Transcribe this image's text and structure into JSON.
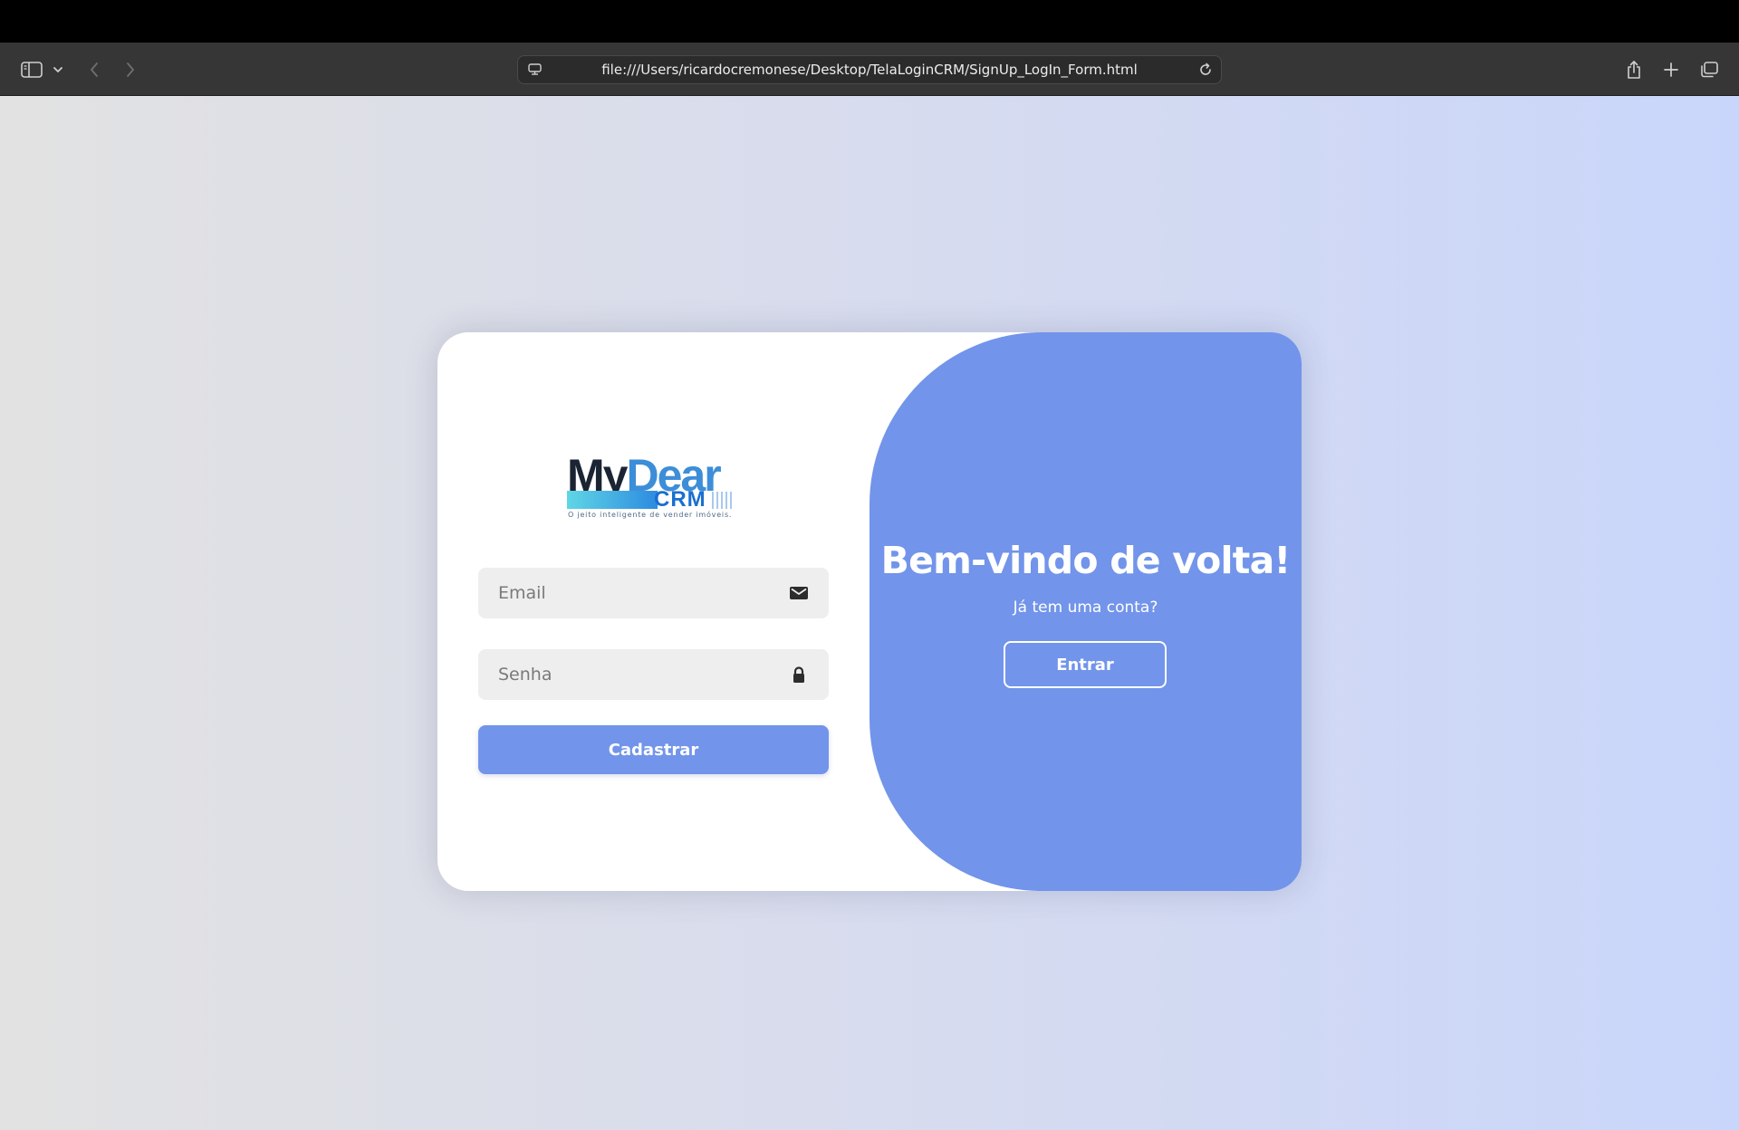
{
  "browser": {
    "url": "file:///Users/ricardocremonese/Desktop/TelaLoginCRM/SignUp_LogIn_Form.html",
    "icons": {
      "sidebar": "sidebar-toggle-icon",
      "sidebar_menu": "chevron-down-icon",
      "back": "chevron-left-icon",
      "forward": "chevron-right-icon",
      "site_info": "page-settings-icon",
      "reload": "reload-icon",
      "share": "share-icon",
      "new_tab": "plus-icon",
      "tab_overview": "tabs-overview-icon"
    }
  },
  "logo": {
    "my": "My",
    "dear": "Dear",
    "crm": "CRM",
    "tagline": "O jeito inteligente de vender imóveis."
  },
  "form": {
    "email_placeholder": "Email",
    "password_placeholder": "Senha",
    "email_icon": "envelope-icon",
    "password_icon": "lock-icon",
    "submit_label": "Cadastrar"
  },
  "welcome": {
    "title": "Bem-vindo de volta!",
    "subtitle": "Já tem uma conta?",
    "login_label": "Entrar"
  },
  "colors": {
    "accent": "#7294ea",
    "card_background": "#ffffff",
    "field_background": "#eeeeee",
    "browser_toolbar": "#363636"
  }
}
